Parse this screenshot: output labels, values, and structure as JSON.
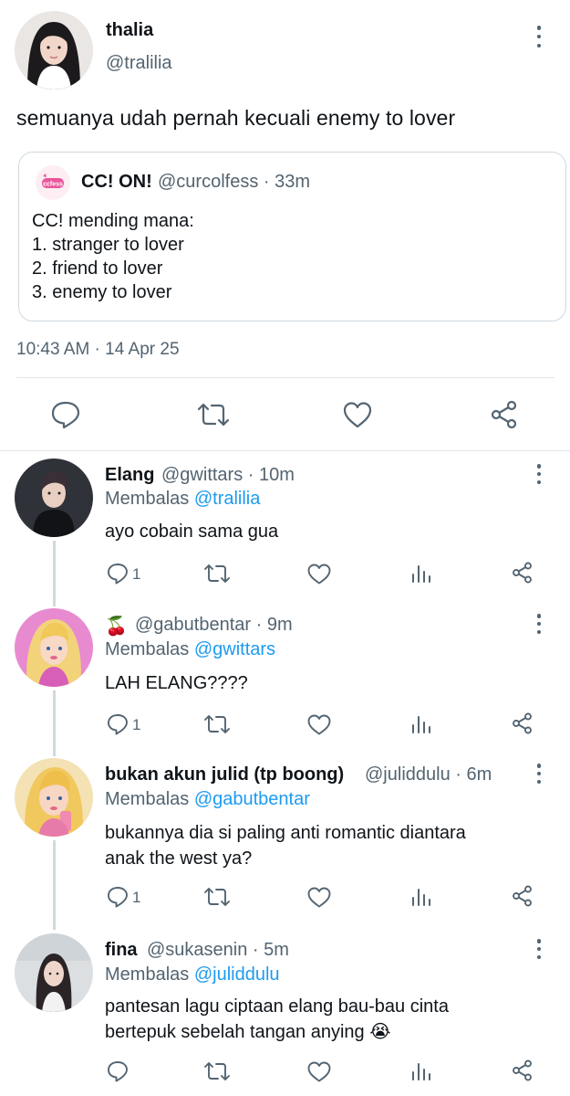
{
  "main_tweet": {
    "author_name": "thalia",
    "author_handle": "@tralilia",
    "text": "semuanya udah pernah kecuali enemy to lover",
    "timestamp": "10:43 AM · 14 Apr 25",
    "quote": {
      "name": "CC! ON!",
      "meta": "@curcolfess · 33m",
      "lines": [
        "CC! mending mana:",
        "1. stranger to lover",
        "2. friend to lover",
        "3. enemy to lover"
      ]
    }
  },
  "actions": {
    "reply_icon": "speech-bubble-icon",
    "retweet_icon": "retweet-icon",
    "like_icon": "heart-icon",
    "share_icon": "share-icon",
    "views_icon": "bar-chart-icon"
  },
  "replies": [
    {
      "name": "Elang",
      "handle": "@gwittars · 10m",
      "replying_prefix": "Membalas",
      "replying_to": "@tralilia",
      "lines": [
        "ayo cobain sama gua"
      ],
      "reply_count": "1"
    },
    {
      "name": "🍒",
      "handle": "@gabutbentar · 9m",
      "replying_prefix": "Membalas",
      "replying_to": "@gwittars",
      "lines": [
        "LAH ELANG????"
      ],
      "reply_count": "1"
    },
    {
      "name": "bukan akun julid (tp boong)",
      "handle": "@juliddulu · 6m",
      "replying_prefix": "Membalas",
      "replying_to": "@gabutbentar",
      "lines": [
        "bukannya dia si paling anti romantic diantara",
        "anak the west ya?"
      ],
      "reply_count": "1"
    },
    {
      "name": "fina",
      "handle": "@sukasenin · 5m",
      "replying_prefix": "Membalas",
      "replying_to": "@juliddulu",
      "lines": [
        "pantesan lagu ciptaan elang bau-bau cinta",
        "bertepuk sebelah tangan anying 😭"
      ],
      "reply_count": ""
    }
  ],
  "colors": {
    "text": "#0f1419",
    "secondary": "#536471",
    "link": "#1d9bf0",
    "border": "#cfd9de"
  }
}
